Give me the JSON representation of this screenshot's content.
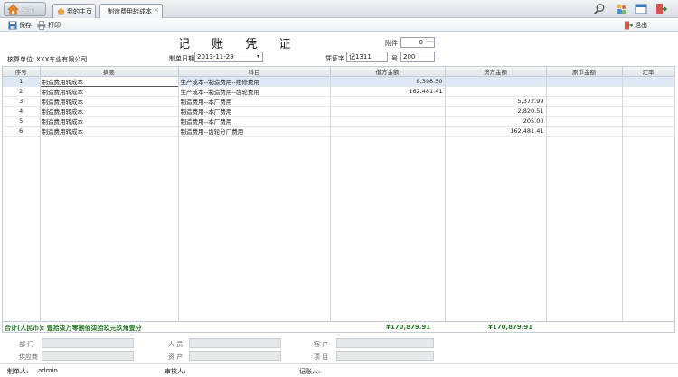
{
  "topbar": {
    "menu_label": "菜单",
    "tabs": [
      {
        "label": "我的主页"
      },
      {
        "label": "制造费用转成本"
      }
    ]
  },
  "toolbar": {
    "save": "保存",
    "print": "打印",
    "exit": "退出"
  },
  "voucher": {
    "title": "记 账 凭 证",
    "attachment_label": "附件",
    "attachment_value": "0",
    "company_label": "核算单位:",
    "company_value": "XXX车业有限公司",
    "date_label": "制单日期",
    "date_value": "2013-11-29",
    "voucher_word_label": "凭证字",
    "voucher_word_value": "记1311",
    "number_label": "号",
    "number_value": "200"
  },
  "table": {
    "headers": [
      "序号",
      "摘要",
      "科目",
      "借方金额",
      "贷方金额",
      "原币金额",
      "汇率"
    ],
    "rows": [
      {
        "no": "1",
        "summary": "制造费用转成本",
        "account": "生产成本--制造费用--维修费用",
        "debit": "8,398.50",
        "credit": "",
        "orig": "",
        "rate": ""
      },
      {
        "no": "2",
        "summary": "制造费用转成本",
        "account": "生产成本--制造费用--齿轮费用",
        "debit": "162,481.41",
        "credit": "",
        "orig": "",
        "rate": ""
      },
      {
        "no": "3",
        "summary": "制造费用转成本",
        "account": "制造费用--本厂费用",
        "debit": "",
        "credit": "5,372.99",
        "orig": "",
        "rate": ""
      },
      {
        "no": "4",
        "summary": "制造费用转成本",
        "account": "制造费用--本厂费用",
        "debit": "",
        "credit": "2,820.51",
        "orig": "",
        "rate": ""
      },
      {
        "no": "5",
        "summary": "制造费用转成本",
        "account": "制造费用--本厂费用",
        "debit": "",
        "credit": "205.00",
        "orig": "",
        "rate": ""
      },
      {
        "no": "6",
        "summary": "制造费用转成本",
        "account": "制造费用--齿轮分厂费用",
        "debit": "",
        "credit": "162,481.41",
        "orig": "",
        "rate": ""
      }
    ],
    "total_label": "合计(人民币): 壹拾柒万零捌佰柒拾玖元玖角壹分",
    "total_debit": "¥170,879.91",
    "total_credit": "¥170,879.91"
  },
  "aux": {
    "department": "部 门",
    "person": "人 员",
    "customer": "客 户",
    "supplier": "供应商",
    "asset": "资 产",
    "project": "项 目"
  },
  "footer": {
    "maker_label": "制单人:",
    "maker_value": "admin",
    "auditor_label": "审核人:",
    "bookkeeper_label": "记账人:"
  }
}
